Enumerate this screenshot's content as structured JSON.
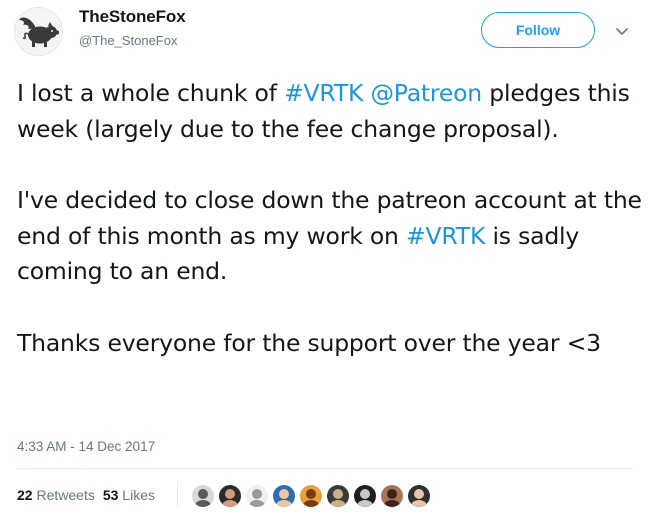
{
  "author": {
    "display_name": "TheStoneFox",
    "handle": "@The_StoneFox",
    "avatar_icon": "winged-pig-logo-icon"
  },
  "follow_button": {
    "label": "Follow",
    "color": "#1da1f2"
  },
  "more_menu": {
    "icon": "chevron-down-icon"
  },
  "tweet": {
    "paragraphs": [
      {
        "segments": [
          {
            "text": "I lost a whole chunk of ",
            "link": false
          },
          {
            "text": "#VRTK",
            "link": true
          },
          {
            "text": " ",
            "link": false
          },
          {
            "text": "@Patreon",
            "link": true
          },
          {
            "text": " pledges this week (largely due to the fee change proposal).",
            "link": false
          }
        ]
      },
      {
        "segments": [
          {
            "text": "I've decided to close down the patreon account at the end of this month as my work on ",
            "link": false
          },
          {
            "text": "#VRTK",
            "link": true
          },
          {
            "text": " is sadly coming to an end.",
            "link": false
          }
        ]
      },
      {
        "segments": [
          {
            "text": "Thanks everyone for the support over the year <3",
            "link": false
          }
        ]
      }
    ],
    "link_color": "#1b95e0",
    "timestamp": "4:33 AM - 14 Dec 2017"
  },
  "stats": {
    "retweets_count": "22",
    "retweets_label": "Retweets",
    "likes_count": "53",
    "likes_label": "Likes"
  },
  "liker_avatars": [
    {
      "name": "liker-avatar-1",
      "bg": "#d8d8d8",
      "fg": "#5a5a5a"
    },
    {
      "name": "liker-avatar-2",
      "bg": "#2b2b2b",
      "fg": "#d79a7a"
    },
    {
      "name": "liker-avatar-3",
      "bg": "#f0f0f0",
      "fg": "#9a9a9a"
    },
    {
      "name": "liker-avatar-4",
      "bg": "#2a6fb0",
      "fg": "#f0c9a0"
    },
    {
      "name": "liker-avatar-5",
      "bg": "#e6a23c",
      "fg": "#7a3b10"
    },
    {
      "name": "liker-avatar-6",
      "bg": "#3a3a3a",
      "fg": "#c9b08a"
    },
    {
      "name": "liker-avatar-7",
      "bg": "#1e1e1e",
      "fg": "#c8c8c8"
    },
    {
      "name": "liker-avatar-8",
      "bg": "#a8745a",
      "fg": "#3c2418"
    },
    {
      "name": "liker-avatar-9",
      "bg": "#2f2f2f",
      "fg": "#e8c4a8"
    }
  ]
}
